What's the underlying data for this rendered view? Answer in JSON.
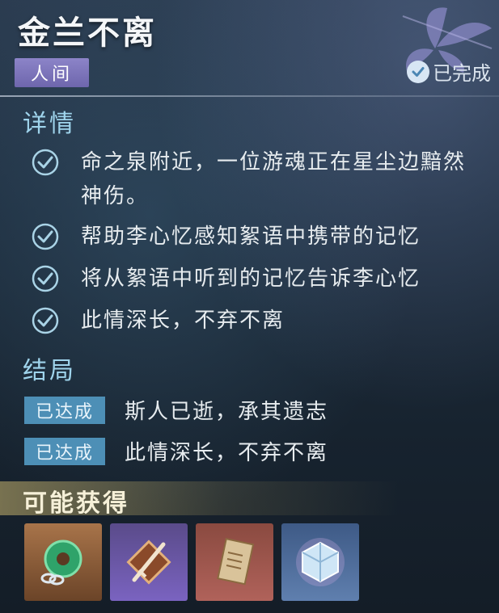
{
  "title": "金兰不离",
  "realm_tag": "人间",
  "status": {
    "label": "已完成",
    "icon": "check-circle-icon"
  },
  "details": {
    "heading": "详情",
    "items": [
      {
        "line1": "命之泉附近，一位游魂正在星尘边黯然",
        "line2": "神伤。"
      },
      {
        "line1": "帮助李心忆感知絮语中携带的记忆"
      },
      {
        "line1": "将从絮语中听到的记忆告诉李心忆"
      },
      {
        "line1": "此情深长，不弃不离"
      }
    ]
  },
  "endings": {
    "heading": "结局",
    "items": [
      {
        "badge": "已达成",
        "text": "斯人已逝，承其遗志"
      },
      {
        "badge": "已达成",
        "text": "此情深长，不弃不离"
      }
    ]
  },
  "rewards": {
    "heading": "可能获得",
    "items": [
      {
        "icon": "jade-ring-icon",
        "rarity_color": "#c8874a"
      },
      {
        "icon": "sword-emblem-icon",
        "rarity_color": "#7e66b8"
      },
      {
        "icon": "scroll-icon",
        "rarity_color": "#b86a5a"
      },
      {
        "icon": "crystal-cube-icon",
        "rarity_color": "#5f7fae"
      }
    ]
  },
  "colors": {
    "section_heading": "#9fd4ec",
    "achieved_badge": "#4d8fb6",
    "realm_tag": "#7e76bd"
  }
}
